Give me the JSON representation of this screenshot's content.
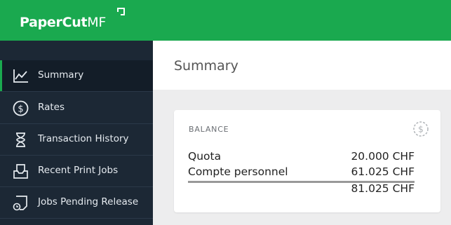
{
  "app": {
    "logo_main": "PaperCut",
    "logo_mf": "MF"
  },
  "sidebar": {
    "items": [
      {
        "label": "Summary",
        "icon": "chart-line-icon",
        "active": true
      },
      {
        "label": "Rates",
        "icon": "dollar-circle-icon"
      },
      {
        "label": "Transaction History",
        "icon": "hourglass-icon"
      },
      {
        "label": "Recent Print Jobs",
        "icon": "print-tray-icon"
      },
      {
        "label": "Jobs Pending Release",
        "icon": "document-clock-icon"
      }
    ]
  },
  "main": {
    "title": "Summary"
  },
  "balance": {
    "heading": "BALANCE",
    "rows": [
      {
        "label": "Quota",
        "value": "20.000 CHF"
      },
      {
        "label": "Compte personnel",
        "value": "61.025 CHF"
      }
    ],
    "total": "81.025 CHF"
  },
  "colors": {
    "brand": "#1aa94f",
    "sidebar": "#1c2835",
    "active": "#131d28"
  }
}
